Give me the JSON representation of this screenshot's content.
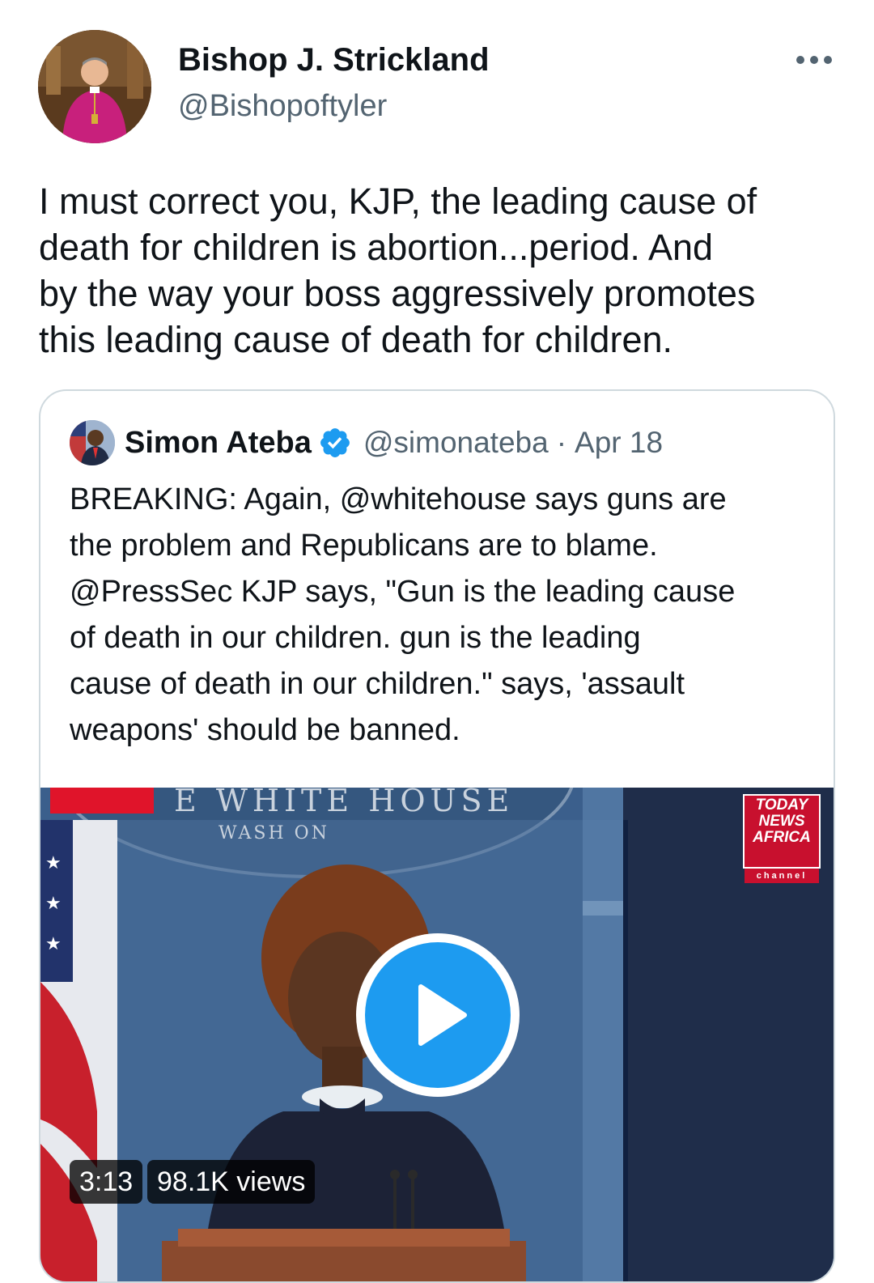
{
  "tweet": {
    "author_name": "Bishop J. Strickland",
    "author_handle": "@Bishopoftyler",
    "text_lines": [
      "I must correct you, KJP, the leading cause of",
      "death for children is abortion...period. And",
      "by the way your boss aggressively promotes",
      "this leading cause of death for children."
    ]
  },
  "quoted_tweet": {
    "author_name": "Simon Ateba",
    "author_handle": "@simonateba",
    "separator": "·",
    "date": "Apr 18",
    "verified": true,
    "text_lines": [
      "BREAKING: Again, @whitehouse says guns are",
      "the problem and Republicans are to blame.",
      "@PressSec KJP says, \"Gun is the leading cause",
      "of death in our children. gun is the leading",
      "cause of death in our children.\" says, 'assault",
      "weapons' should be banned."
    ],
    "video": {
      "duration": "3:13",
      "views": "98.1K views",
      "seal_text": "E WHITE HOUSE",
      "seal_subtext": "WASH      ON",
      "channel_logo_lines": [
        "TODAY",
        "NEWS",
        "AFRICA"
      ],
      "channel_logo_sub": "channel"
    }
  },
  "icons": {
    "more": "more-horizontal-icon",
    "verified": "verified-badge-icon",
    "play": "play-icon"
  },
  "colors": {
    "text_primary": "#0f1419",
    "text_secondary": "#536471",
    "accent": "#1d9bf0",
    "border": "#cfd9de"
  }
}
